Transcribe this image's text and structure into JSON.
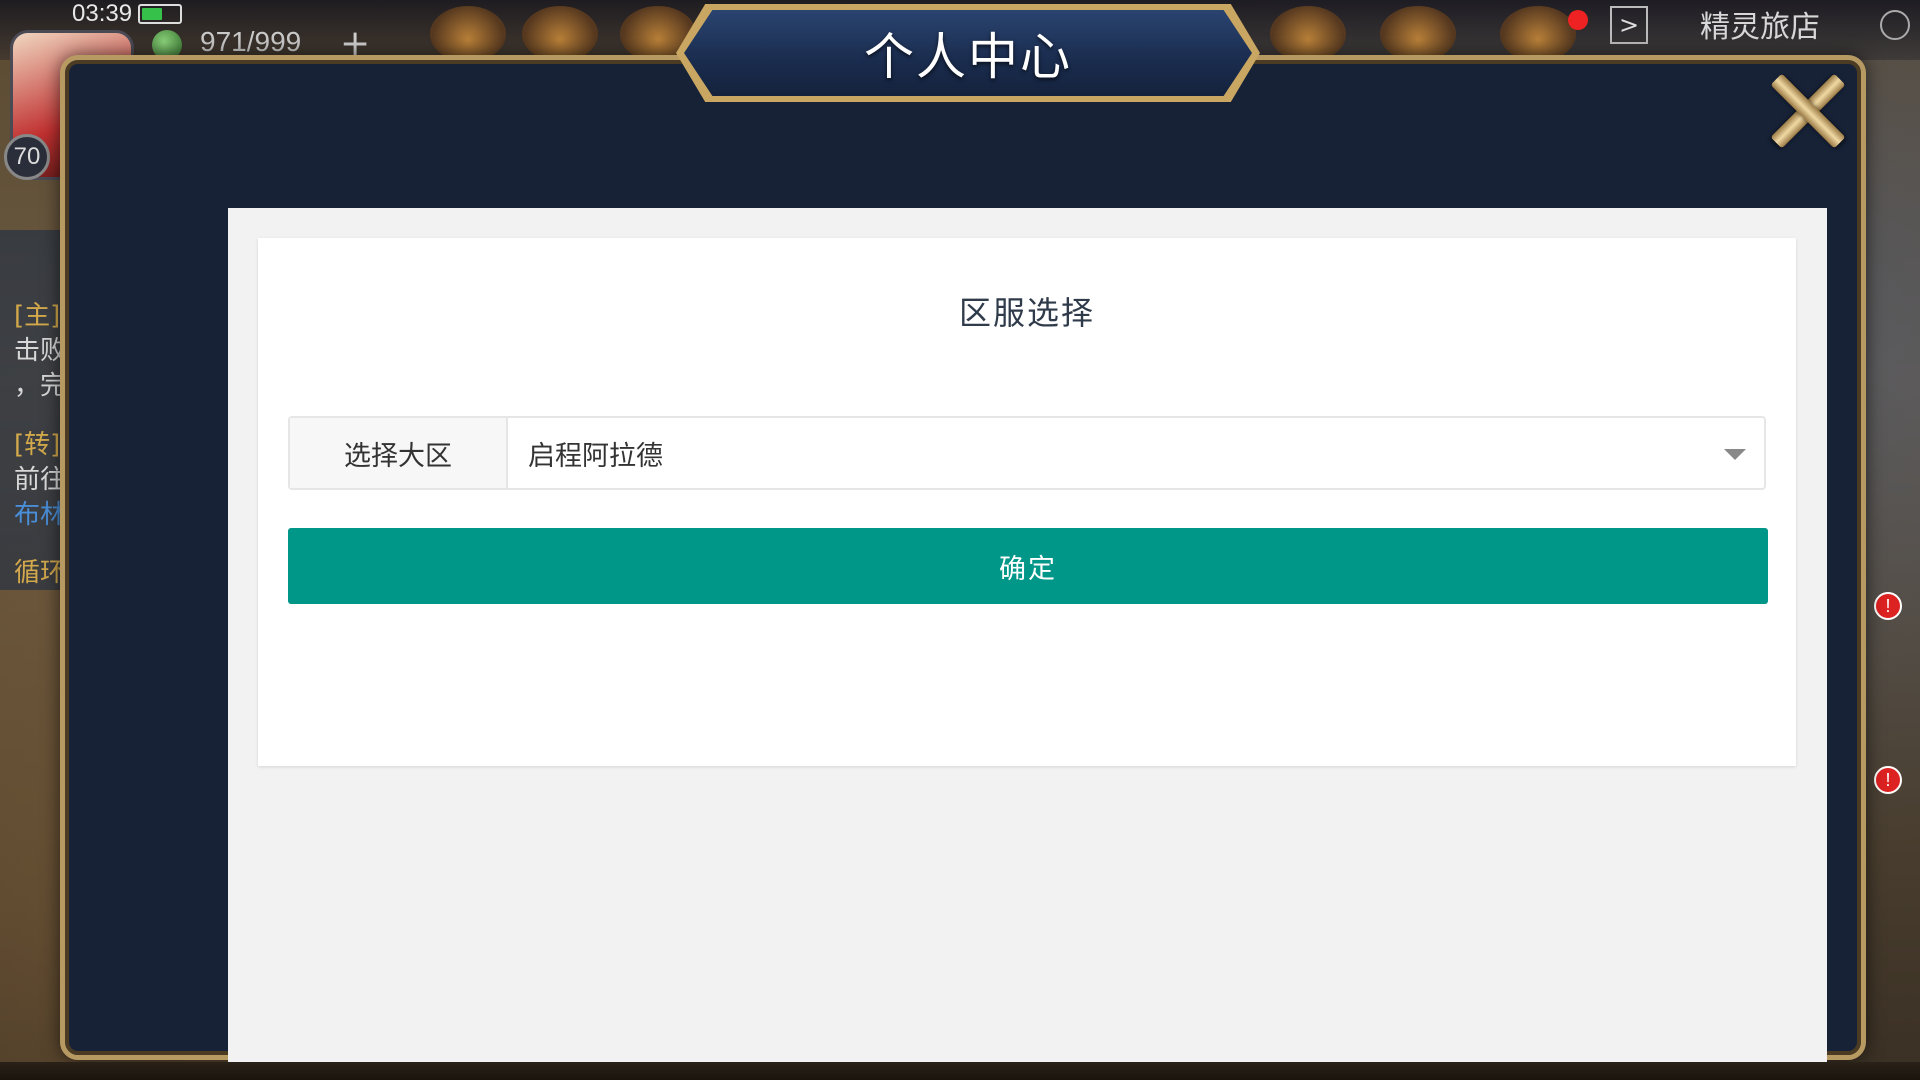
{
  "status": {
    "time": "03:39",
    "battery_level": 0.55
  },
  "hud": {
    "stamina": "971/999",
    "plus": "+",
    "level": "70",
    "shop_label": "精灵旅店",
    "side_labels": [
      "[主]",
      "击败",
      "，完",
      "[转]",
      "前往",
      "布林",
      "循环"
    ],
    "badges": [
      "!",
      "!"
    ]
  },
  "dialog": {
    "title": "个人中心",
    "close_icon": "close-icon"
  },
  "server_select": {
    "heading": "区服选择",
    "field_label": "选择大区",
    "selected_value": "启程阿拉德",
    "confirm_label": "确定"
  },
  "colors": {
    "primary_button": "#009688",
    "frame_gold": "#b79a62",
    "frame_bg": "#172237"
  }
}
